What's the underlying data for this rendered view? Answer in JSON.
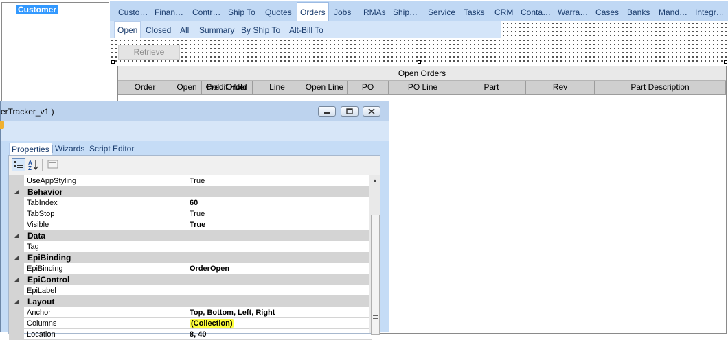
{
  "left_panel": {
    "tree_node": "Customer"
  },
  "main_tabs": [
    "Custo…",
    "Finan…",
    "Contr…",
    "Ship To",
    "Quotes",
    "Orders",
    "Jobs",
    "RMAs",
    "Ship…",
    "Service",
    "Tasks",
    "CRM",
    "Conta…",
    "Warra…",
    "Cases",
    "Banks",
    "Mand…",
    "Integr…"
  ],
  "main_tab_active": "Orders",
  "sub_tabs": [
    "Open",
    "Closed",
    "All",
    "Summary",
    "By Ship To",
    "Alt-Bill To"
  ],
  "sub_tab_active": "Open",
  "retrieve_label": "Retrieve",
  "grid": {
    "title": "Open Orders",
    "columns": [
      "Order",
      "Open",
      "Hold Order",
      "Credit Hold",
      "Line",
      "Open Line",
      "PO",
      "PO Line",
      "Part",
      "Rev",
      "Part Description"
    ]
  },
  "props_window": {
    "title": "erTracker_v1 )",
    "tabs": [
      "Properties",
      "Wizards",
      "Script Editor"
    ],
    "rows": [
      {
        "kind": "prop",
        "name": "UseAppStyling",
        "value": "True",
        "bold": false
      },
      {
        "kind": "cat",
        "name": "Behavior"
      },
      {
        "kind": "prop",
        "name": "TabIndex",
        "value": "60",
        "bold": true
      },
      {
        "kind": "prop",
        "name": "TabStop",
        "value": "True",
        "bold": false
      },
      {
        "kind": "prop",
        "name": "Visible",
        "value": "True",
        "bold": true
      },
      {
        "kind": "cat",
        "name": "Data"
      },
      {
        "kind": "prop",
        "name": "Tag",
        "value": "",
        "bold": false
      },
      {
        "kind": "cat",
        "name": "EpiBinding"
      },
      {
        "kind": "prop",
        "name": "EpiBinding",
        "value": "OrderOpen",
        "bold": true
      },
      {
        "kind": "cat",
        "name": "EpiControl"
      },
      {
        "kind": "prop",
        "name": "EpiLabel",
        "value": "",
        "bold": false
      },
      {
        "kind": "cat",
        "name": "Layout"
      },
      {
        "kind": "prop",
        "name": "Anchor",
        "value": "Top, Bottom, Left, Right",
        "bold": true
      },
      {
        "kind": "prop",
        "name": "Columns",
        "value": "(Collection)",
        "bold": true,
        "highlight": true
      },
      {
        "kind": "prop",
        "name": "Location",
        "value": "8, 40",
        "bold": true
      }
    ]
  },
  "icons": {
    "categorized": "categorized-view-icon",
    "alphabetical": "alphabetical-sort-icon",
    "property_pages": "property-pages-icon",
    "minimize": "minimize-icon",
    "restore": "restore-icon",
    "close": "close-icon",
    "scroll_up": "scroll-up-arrow-icon",
    "collapse": "collapse-triangle-icon",
    "pencil": "pencil-icon"
  },
  "colors": {
    "highlight": "#ffff3d",
    "selection": "#3399ff",
    "tab_strip": "#c0d8f4",
    "category_row": "#d4d4d4"
  }
}
